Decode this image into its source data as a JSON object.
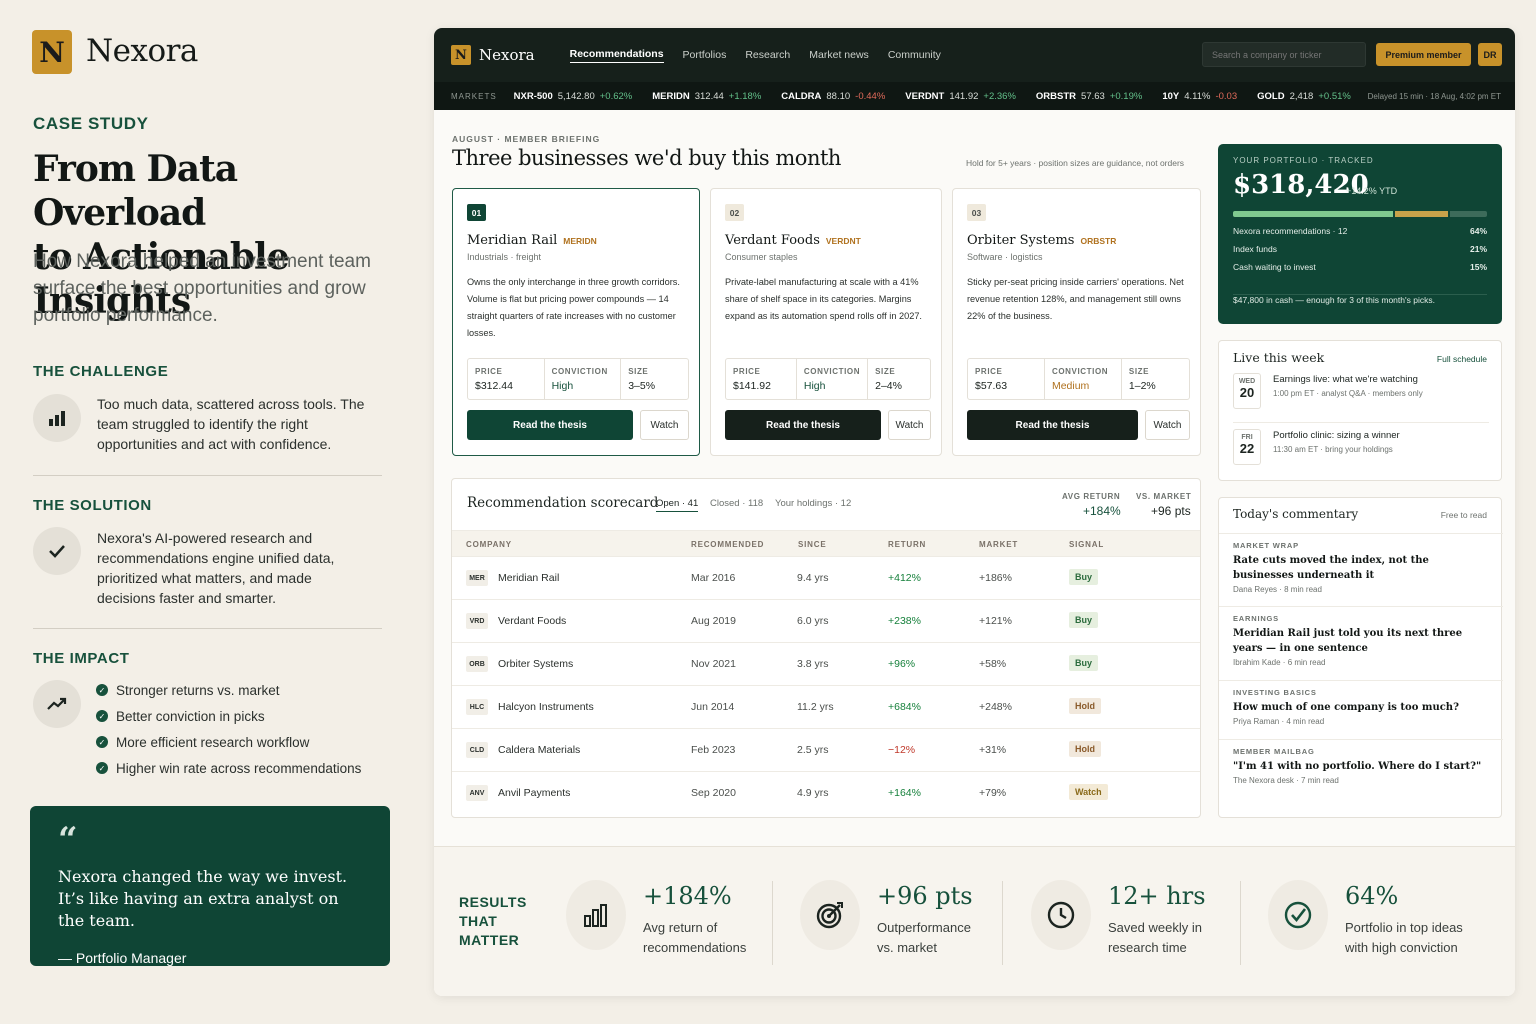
{
  "brand": {
    "letter": "N",
    "name": "Nexora"
  },
  "left": {
    "kicker": "CASE STUDY",
    "title_l1": "From Data Overload",
    "title_l2": "to Actionable Insights",
    "lede": "How Nexora helped an investment team surface the best opportunities and grow portfolio performance.",
    "challenge": {
      "heading": "THE CHALLENGE",
      "text": "Too much data, scattered across tools. The team struggled to identify the right opportunities and act with confidence."
    },
    "solution": {
      "heading": "THE SOLUTION",
      "text": "Nexora's AI-powered research and recommendations engine unified data, prioritized what matters, and made decisions faster and smarter."
    },
    "impact": {
      "heading": "THE IMPACT",
      "items": [
        "Stronger returns vs. market",
        "Better conviction in picks",
        "More efficient research workflow",
        "Higher win rate across recommendations"
      ]
    },
    "quote": {
      "mark": "“",
      "line1": "Nexora changed the way we invest.",
      "line2": "It’s like having an extra analyst on the team.",
      "author": "— Portfolio Manager"
    }
  },
  "nav": {
    "links": [
      "Recommendations",
      "Portfolios",
      "Research",
      "Market news",
      "Community"
    ],
    "search_placeholder": "Search a company or ticker",
    "premium": "Premium member",
    "avatar": "DR"
  },
  "ticker": {
    "label": "MARKETS",
    "items": [
      {
        "sym": "NXR-500",
        "val": "5,142.80",
        "chg": "+0.62%",
        "dir": "up"
      },
      {
        "sym": "MERIDN",
        "val": "312.44",
        "chg": "+1.18%",
        "dir": "up"
      },
      {
        "sym": "CALDRA",
        "val": "88.10",
        "chg": "-0.44%",
        "dir": "dn"
      },
      {
        "sym": "VERDNT",
        "val": "141.92",
        "chg": "+2.36%",
        "dir": "up"
      },
      {
        "sym": "ORBSTR",
        "val": "57.63",
        "chg": "+0.19%",
        "dir": "up"
      },
      {
        "sym": "10Y",
        "val": "4.11%",
        "chg": "-0.03",
        "dir": "dn"
      },
      {
        "sym": "GOLD",
        "val": "2,418",
        "chg": "+0.51%",
        "dir": "up"
      }
    ],
    "delay": "Delayed 15 min · 18 Aug, 4:02 pm ET"
  },
  "briefing": {
    "tag": "AUGUST · MEMBER BRIEFING",
    "title": "Three businesses we'd buy this month",
    "note": "Hold for 5+ years · position sizes are guidance, not orders",
    "price_label": "PRICE",
    "conviction_label": "CONVICTION",
    "size_label": "SIZE",
    "read": "Read the thesis",
    "watch": "Watch",
    "picks": [
      {
        "num": "01",
        "name": "Meridian Rail",
        "ticker": "MERIDN",
        "sector": "Industrials · freight",
        "desc": "Owns the only interchange in three growth corridors. Volume is flat but pricing power compounds — 14 straight quarters of rate increases with no customer losses.",
        "price": "$312.44",
        "conviction": "High",
        "size": "3–5%"
      },
      {
        "num": "02",
        "name": "Verdant Foods",
        "ticker": "VERDNT",
        "sector": "Consumer staples",
        "desc": "Private-label manufacturing at scale with a 41% share of shelf space in its categories. Margins expand as its automation spend rolls off in 2027.",
        "price": "$141.92",
        "conviction": "High",
        "size": "2–4%"
      },
      {
        "num": "03",
        "name": "Orbiter Systems",
        "ticker": "ORBSTR",
        "sector": "Software · logistics",
        "desc": "Sticky per-seat pricing inside carriers' operations. Net revenue retention 128%, and management still owns 22% of the business.",
        "price": "$57.63",
        "conviction": "Medium",
        "size": "1–2%"
      }
    ]
  },
  "portfolio": {
    "tag": "YOUR PORTFOLIO · TRACKED",
    "value": "$318,420",
    "ytd": "+14.2% YTD",
    "segments": [
      64,
      21,
      15
    ],
    "rows": [
      {
        "label": "Nexora recommendations · 12",
        "pct": "64%"
      },
      {
        "label": "Index funds",
        "pct": "21%"
      },
      {
        "label": "Cash waiting to invest",
        "pct": "15%"
      }
    ],
    "note": "$47,800 in cash — enough for 3 of this month's picks."
  },
  "live": {
    "title": "Live this week",
    "link": "Full schedule",
    "events": [
      {
        "dow": "WED",
        "day": "20",
        "title": "Earnings live: what we're watching",
        "meta": "1:00 pm ET · analyst Q&A · members only"
      },
      {
        "dow": "FRI",
        "day": "22",
        "title": "Portfolio clinic: sizing a winner",
        "meta": "11:30 am ET · bring your holdings"
      }
    ]
  },
  "scorecard": {
    "title": "Recommendation scorecard",
    "tabs": [
      "Open · 41",
      "Closed · 118",
      "Your holdings · 12"
    ],
    "avg_label": "AVG RETURN",
    "avg_val": "+184%",
    "vs_label": "VS. MARKET",
    "vs_val": "+96 pts",
    "headers": [
      "COMPANY",
      "RECOMMENDED",
      "SINCE",
      "RETURN",
      "MARKET",
      "SIGNAL"
    ],
    "rows": [
      {
        "code": "MER",
        "company": "Meridian Rail",
        "rec": "Mar 2016",
        "since": "9.4 yrs",
        "ret": "+412%",
        "mkt": "+186%",
        "signal": "Buy",
        "neg": false
      },
      {
        "code": "VRD",
        "company": "Verdant Foods",
        "rec": "Aug 2019",
        "since": "6.0 yrs",
        "ret": "+238%",
        "mkt": "+121%",
        "signal": "Buy",
        "neg": false
      },
      {
        "code": "ORB",
        "company": "Orbiter Systems",
        "rec": "Nov 2021",
        "since": "3.8 yrs",
        "ret": "+96%",
        "mkt": "+58%",
        "signal": "Buy",
        "neg": false
      },
      {
        "code": "HLC",
        "company": "Halcyon Instruments",
        "rec": "Jun 2014",
        "since": "11.2 yrs",
        "ret": "+684%",
        "mkt": "+248%",
        "signal": "Hold",
        "neg": false
      },
      {
        "code": "CLD",
        "company": "Caldera Materials",
        "rec": "Feb 2023",
        "since": "2.5 yrs",
        "ret": "−12%",
        "mkt": "+31%",
        "signal": "Hold",
        "neg": true
      },
      {
        "code": "ANV",
        "company": "Anvil Payments",
        "rec": "Sep 2020",
        "since": "4.9 yrs",
        "ret": "+164%",
        "mkt": "+79%",
        "signal": "Watch",
        "neg": false
      }
    ]
  },
  "commentary": {
    "title": "Today's commentary",
    "free": "Free to read",
    "items": [
      {
        "tag": "MARKET WRAP",
        "title": "Rate cuts moved the index, not the businesses underneath it",
        "meta": "Dana Reyes · 8 min read"
      },
      {
        "tag": "EARNINGS",
        "title": "Meridian Rail just told you its next three years — in one sentence",
        "meta": "Ibrahim Kade · 6 min read"
      },
      {
        "tag": "INVESTING BASICS",
        "title": "How much of one company is too much?",
        "meta": "Priya Raman · 4 min read"
      },
      {
        "tag": "MEMBER MAILBAG",
        "title": "\"I'm 41 with no portfolio. Where do I start?\"",
        "meta": "The Nexora desk · 7 min read"
      }
    ]
  },
  "results": {
    "heading": [
      "RESULTS",
      "THAT",
      "MATTER"
    ],
    "items": [
      {
        "icon": "bar-chart-icon",
        "num": "+184%",
        "l1": "Avg return of",
        "l2": "recommendations"
      },
      {
        "icon": "target-icon",
        "num": "+96 pts",
        "l1": "Outperformance",
        "l2": "vs. market"
      },
      {
        "icon": "clock-icon",
        "num": "12+ hrs",
        "l1": "Saved weekly in",
        "l2": "research time"
      },
      {
        "icon": "check-circle-icon",
        "num": "64%",
        "l1": "Portfolio in top ideas",
        "l2": "with high conviction"
      }
    ]
  },
  "colors": {
    "accent_green": "#0f4535",
    "gold": "#c8922a",
    "nav_bg": "#16201b"
  }
}
